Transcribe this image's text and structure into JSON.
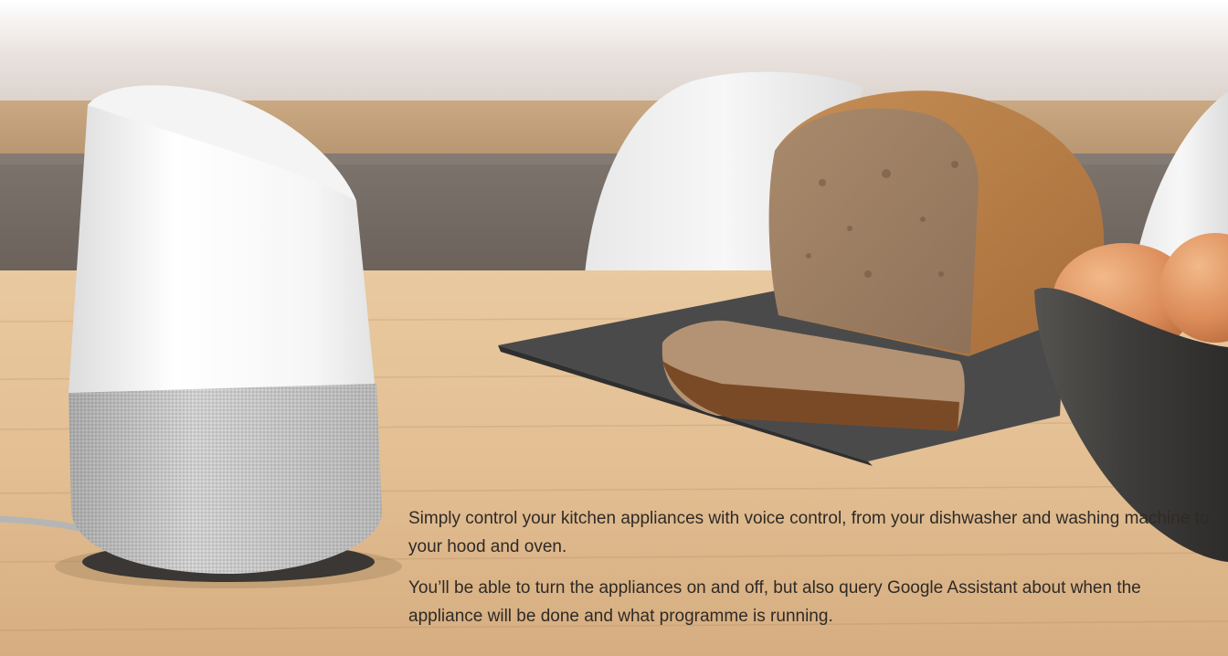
{
  "content": {
    "paragraph_1": "Simply control your kitchen appliances with voice control, from your dishwasher and washing machine to your hood and oven.",
    "paragraph_2": "You’ll be able to turn the appliances on and off, but also query Google Assistant about when the appliance will be done and what programme is running."
  }
}
